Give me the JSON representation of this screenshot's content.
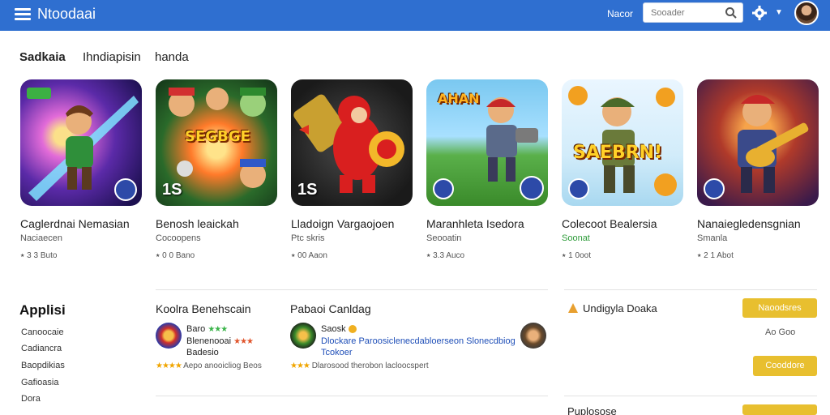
{
  "header": {
    "title": "Ntoodaai",
    "nav_link": "Nacor",
    "search_placeholder": "Sooader",
    "accent": "#2f6fd0"
  },
  "tabs": [
    {
      "label": "Sadkaia",
      "active": true
    },
    {
      "label": "Ihndiapisin",
      "active": false
    },
    {
      "label": "handa",
      "active": false
    }
  ],
  "games": [
    {
      "title": "Caglerdnai Nemasian",
      "subtitle": "Naciaecen",
      "meta": "⭑ 3 3 Buto",
      "badge": "",
      "sub_color": "default",
      "logo": "",
      "icon": "sword-hero-art"
    },
    {
      "title": "Benosh leaickah",
      "subtitle": "Cocoopens",
      "meta": "⭑ 0 0 Bano",
      "badge": "1S",
      "sub_color": "default",
      "logo": "SEGBGE",
      "icon": "squad-art"
    },
    {
      "title": "Lladoign Vargaojoen",
      "subtitle": "Ptc skris",
      "meta": "⭑ 00 Aaon",
      "badge": "1S",
      "sub_color": "default",
      "logo": "",
      "icon": "red-bear-art"
    },
    {
      "title": "Maranhleta Isedora",
      "subtitle": "Seooatin",
      "meta": "⭑ 3.3 Auco",
      "badge": "",
      "sub_color": "default",
      "logo": "AHAN",
      "icon": "soldier-art"
    },
    {
      "title": "Colecoot Bealersia",
      "subtitle": "Soonat",
      "meta": "⭑ 1 0oot",
      "badge": "",
      "sub_color": "green",
      "logo": "SAEBRN!",
      "icon": "army-art"
    },
    {
      "title": "Nanaiegledensgnian",
      "subtitle": "Smanla",
      "meta": "⭑ 2 1 Abot",
      "badge": "",
      "sub_color": "default",
      "logo": "",
      "icon": "guitar-hero-art"
    }
  ],
  "apps_section": {
    "title": "Applisi",
    "sidebar": [
      "Canoocaie",
      "Cadiancra",
      "Baopdikias",
      "Gafioasia",
      "Dora"
    ]
  },
  "list_columns": [
    {
      "head": "Koolra Benehscain",
      "name": "Baro",
      "name_stars": "★★★",
      "desc": "Blenenooai",
      "desc_stars": "★★★",
      "extra": "Badesio",
      "rating_stars": "★★★★",
      "rating_text": "Aepo anooicliog Beos"
    },
    {
      "head": "Pabaoi Canldag",
      "name": "Saosk",
      "desc": "Dlockare Paroosiclenecdabloerseon Slonecdbiog",
      "extra": "Tcokoer",
      "rating_stars": "★★★",
      "rating_text": "Dlarosood therobon lacloocspert"
    }
  ],
  "right_panel": {
    "title": "Undigyla Doaka",
    "button1": "Naoodsres",
    "meta": "Ao Goo",
    "button2": "Cooddore",
    "footer_label": "Puplosose"
  }
}
